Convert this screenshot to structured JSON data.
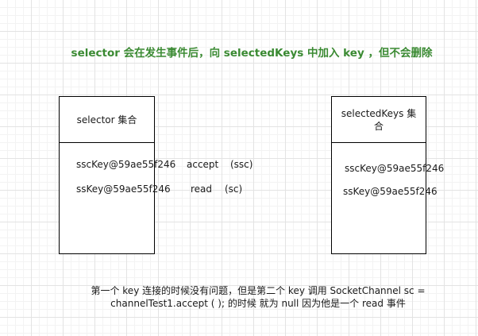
{
  "title": "selector 会在发生事件后，向 selectedKeys 中加入 key ，但不会删除",
  "selector_box": {
    "label": "selector 集合",
    "rows": [
      {
        "key": "sscKey@59ae55f246",
        "op": "accept",
        "channel": "(ssc)"
      },
      {
        "key": "ssKey@59ae55f246",
        "op": "read",
        "channel": "(sc)"
      }
    ]
  },
  "selected_keys_box": {
    "label": "selectedKeys 集合",
    "rows": [
      "sscKey@59ae55f246",
      "ssKey@59ae55f246"
    ]
  },
  "footnote": "第一个 key 连接的时候没有问题，但是第二个 key 调用 SocketChannel sc = channelTest1.accept ( ); 的时候 就为 null 因为他是一个 read 事件",
  "colors": {
    "title": "#3a8a32",
    "border": "#000000"
  }
}
